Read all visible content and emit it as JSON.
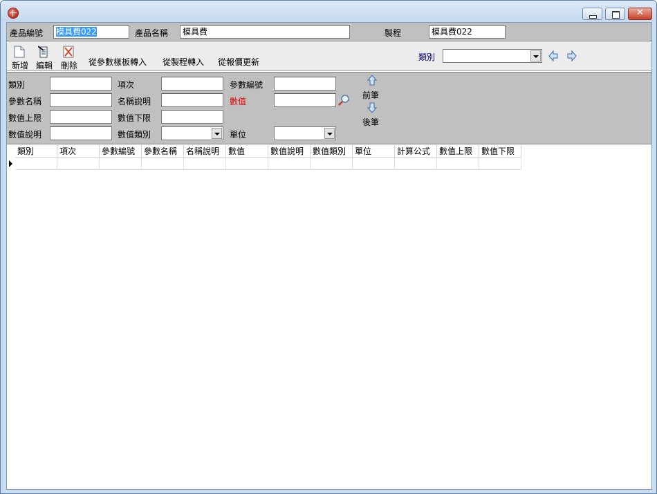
{
  "header": {
    "product_no_label": "產品編號",
    "product_no_value": "模具費022",
    "product_name_label": "產品名稱",
    "product_name_value": "模具費",
    "process_label": "製程",
    "process_value": "模具費022"
  },
  "toolbar": {
    "new_label": "新增",
    "edit_label": "編輯",
    "delete_label": "刪除",
    "import_template_label": "從參數樣板轉入",
    "import_process_label": "從製程轉入",
    "update_quote_label": "從報價更新",
    "category_label": "類別",
    "category_value": ""
  },
  "form": {
    "category_label": "類別",
    "category_value": "",
    "item_no_label": "項次",
    "item_no_value": "",
    "param_no_label": "參數編號",
    "param_no_value": "",
    "param_name_label": "參數名稱",
    "param_name_value": "",
    "name_desc_label": "名稱說明",
    "name_desc_value": "",
    "value_label": "數值",
    "value_value": "",
    "upper_limit_label": "數值上限",
    "upper_limit_value": "",
    "lower_limit_label": "數值下限",
    "lower_limit_value": "",
    "value_desc_label": "數值說明",
    "value_desc_value": "",
    "value_type_label": "數值類別",
    "value_type_value": "",
    "unit_label": "單位",
    "unit_value": "",
    "prev_label": "前筆",
    "next_label": "後筆"
  },
  "grid": {
    "columns": [
      "類別",
      "項次",
      "參數編號",
      "參數名稱",
      "名稱說明",
      "數值",
      "數值說明",
      "數值類別",
      "單位",
      "計算公式",
      "數值上限",
      "數值下限"
    ]
  },
  "colors": {
    "panel_gray": "#c0c0c0",
    "selection_blue": "#3399ff",
    "required_red": "#e00000",
    "label_navy": "#00007f"
  },
  "icons": [
    "app-globe-icon",
    "minimize-icon",
    "maximize-icon",
    "close-icon",
    "new-document-icon",
    "edit-document-icon",
    "delete-icon",
    "arrow-left-icon",
    "arrow-right-icon",
    "magnifier-icon",
    "row-pointer-icon"
  ]
}
